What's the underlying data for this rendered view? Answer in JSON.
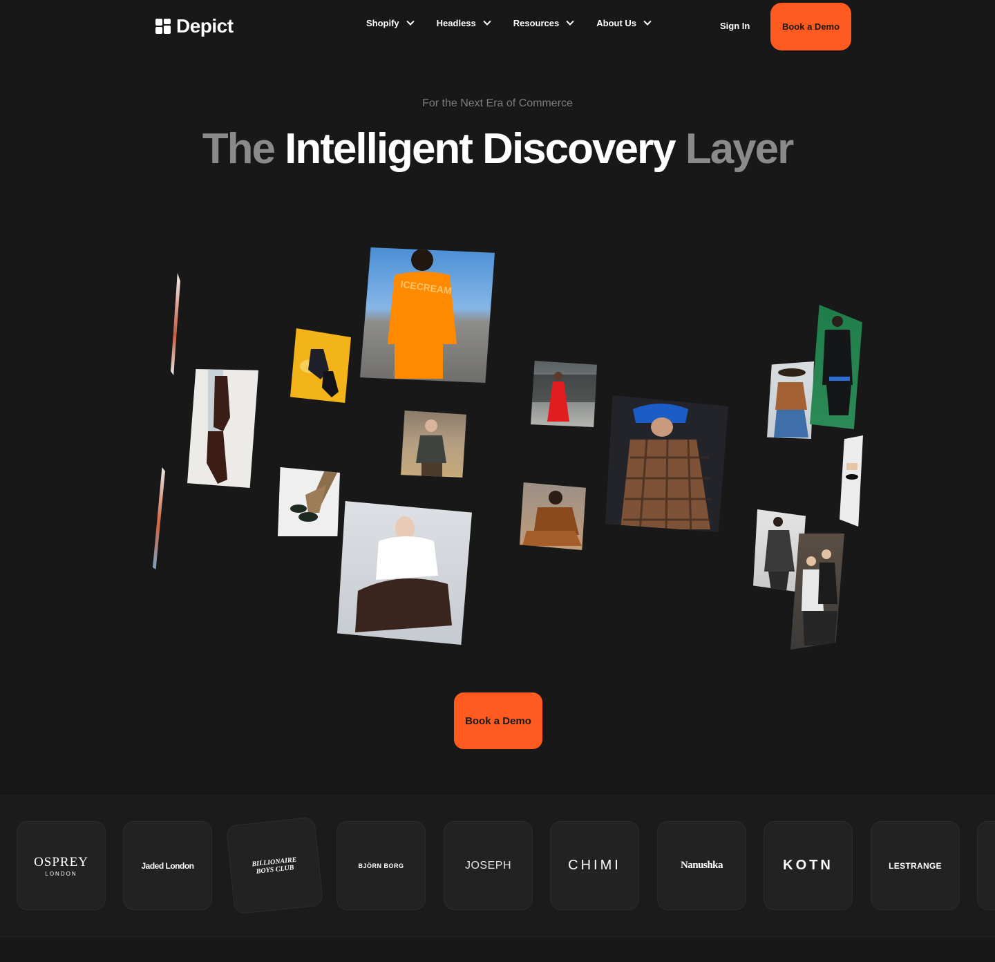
{
  "header": {
    "brand": "Depict",
    "nav": [
      {
        "label": "Shopify"
      },
      {
        "label": "Headless"
      },
      {
        "label": "Resources"
      },
      {
        "label": "About Us"
      }
    ],
    "sign_in": "Sign In",
    "cta": "Book a Demo"
  },
  "hero": {
    "eyebrow": "For the Next Era of Commerce",
    "headline": {
      "part1": "The",
      "part2": "Intelligent Discovery",
      "part3": "Layer"
    },
    "cta": "Book a Demo"
  },
  "brands": {
    "osprey": {
      "line1": "OSPREY",
      "line2": "LONDON"
    },
    "jaded": "Jaded London",
    "bbc": {
      "line1": "BILLIONAIRE",
      "line2": "BOYS CLUB"
    },
    "bjorn": "BJÖRN BORG",
    "joseph": "JOSEPH",
    "chimi": "CHIMI",
    "nanushka": "Nanushka",
    "kotn": "KOTN",
    "lestrange": "LESTRANGE"
  },
  "colors": {
    "background": "#181818",
    "accent": "#ff5a1f",
    "card": "#222222"
  }
}
